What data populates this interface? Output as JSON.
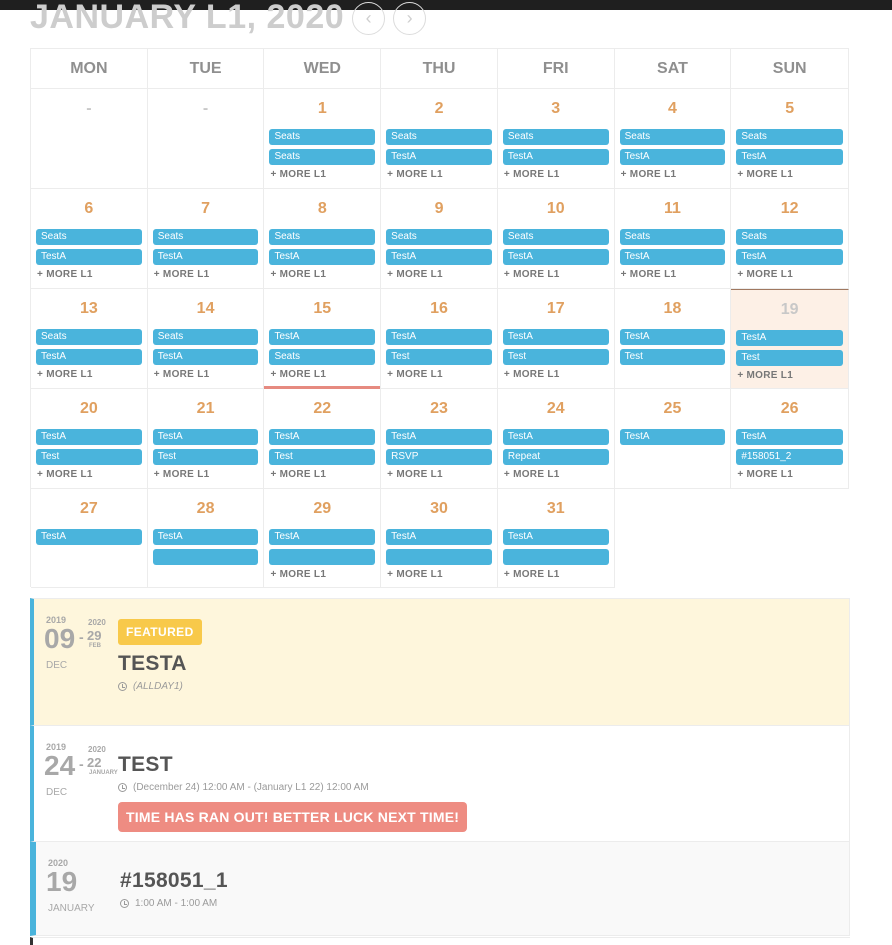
{
  "month": {
    "title": "JANUARY L1, 2020",
    "prev_icon": "chevron-left-icon",
    "next_icon": "chevron-right-icon",
    "prev_glyph": "‹",
    "next_glyph": "›"
  },
  "weekdays": [
    "MON",
    "TUE",
    "WED",
    "THU",
    "FRI",
    "SAT",
    "SUN"
  ],
  "more_label": "+ MORE L1",
  "accent_color": "#4ab4dc",
  "weeks": [
    [
      {
        "num": "-",
        "dim": true,
        "events": [],
        "more": false
      },
      {
        "num": "-",
        "dim": true,
        "events": [],
        "more": false
      },
      {
        "num": "1",
        "events": [
          "Seats",
          "Seats"
        ],
        "more": true
      },
      {
        "num": "2",
        "events": [
          "Seats",
          "TestA"
        ],
        "more": true
      },
      {
        "num": "3",
        "events": [
          "Seats",
          "TestA"
        ],
        "more": true
      },
      {
        "num": "4",
        "events": [
          "Seats",
          "TestA"
        ],
        "more": true
      },
      {
        "num": "5",
        "events": [
          "Seats",
          "TestA"
        ],
        "more": true
      }
    ],
    [
      {
        "num": "6",
        "events": [
          "Seats",
          "TestA"
        ],
        "more": true
      },
      {
        "num": "7",
        "events": [
          "Seats",
          "TestA"
        ],
        "more": true
      },
      {
        "num": "8",
        "events": [
          "Seats",
          "TestA"
        ],
        "more": true
      },
      {
        "num": "9",
        "events": [
          "Seats",
          "TestA"
        ],
        "more": true
      },
      {
        "num": "10",
        "events": [
          "Seats",
          "TestA"
        ],
        "more": true
      },
      {
        "num": "11",
        "events": [
          "Seats",
          "TestA"
        ],
        "more": true
      },
      {
        "num": "12",
        "events": [
          "Seats",
          "TestA"
        ],
        "more": true
      }
    ],
    [
      {
        "num": "13",
        "events": [
          "Seats",
          "TestA"
        ],
        "more": true
      },
      {
        "num": "14",
        "events": [
          "Seats",
          "TestA"
        ],
        "more": true
      },
      {
        "num": "15",
        "events": [
          "TestA",
          "Seats"
        ],
        "more": true,
        "ruler": true
      },
      {
        "num": "16",
        "events": [
          "TestA",
          "Test"
        ],
        "more": true
      },
      {
        "num": "17",
        "events": [
          "TestA",
          "Test"
        ],
        "more": true
      },
      {
        "num": "18",
        "events": [
          "TestA",
          "Test"
        ],
        "more": false
      },
      {
        "num": "19",
        "events": [
          "TestA",
          "Test"
        ],
        "more": true,
        "today": true
      }
    ],
    [
      {
        "num": "20",
        "events": [
          "TestA",
          "Test"
        ],
        "more": true
      },
      {
        "num": "21",
        "events": [
          "TestA",
          "Test"
        ],
        "more": true
      },
      {
        "num": "22",
        "events": [
          "TestA",
          "Test"
        ],
        "more": true
      },
      {
        "num": "23",
        "events": [
          "TestA",
          "RSVP"
        ],
        "more": true
      },
      {
        "num": "24",
        "events": [
          "TestA",
          "Repeat"
        ],
        "more": true
      },
      {
        "num": "25",
        "events": [
          "TestA"
        ],
        "more": false
      },
      {
        "num": "26",
        "events": [
          "TestA",
          "#158051_2"
        ],
        "more": true
      }
    ],
    [
      {
        "num": "27",
        "events": [
          "TestA"
        ],
        "more": false
      },
      {
        "num": "28",
        "events": [
          "TestA",
          ""
        ],
        "more": false
      },
      {
        "num": "29",
        "events": [
          "TestA",
          ""
        ],
        "more": true
      },
      {
        "num": "30",
        "events": [
          "TestA",
          ""
        ],
        "more": true
      },
      {
        "num": "31",
        "events": [
          "TestA",
          ""
        ],
        "more": true
      },
      {
        "num": null,
        "empty": true
      },
      {
        "num": null,
        "empty": true
      }
    ]
  ],
  "event_cards": [
    {
      "style": "featured",
      "year_start": "2019",
      "day_start": "09",
      "month_start": "DEC",
      "year_end": "2020",
      "day_end": "29",
      "month_end": "FEB",
      "dash": "-",
      "badge": "FEATURED",
      "title": "TESTA",
      "time": "(ALLDAY1)",
      "italic": true
    },
    {
      "style": "plain",
      "year_start": "2019",
      "day_start": "24",
      "month_start": "DEC",
      "year_end": "2020",
      "day_end": "22",
      "month_end": "JANUARY",
      "dash": "-",
      "title": "TEST",
      "time": "(December 24) 12:00 AM - (January L1 22) 12:00 AM",
      "notice": "TIME HAS RAN OUT! BETTER LUCK NEXT TIME!"
    },
    {
      "style": "grey",
      "year_start": "2020",
      "day_start": "19",
      "month_start": "JANUARY",
      "title": "#158051_1",
      "time": "1:00 AM - 1:00 AM"
    }
  ]
}
